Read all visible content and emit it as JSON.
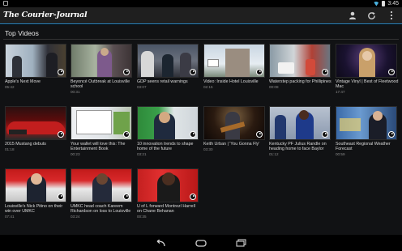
{
  "status": {
    "time": "3:45"
  },
  "app": {
    "brand": "The Courier-Journal"
  },
  "section": {
    "title": "Top Videos"
  },
  "icons": {
    "profile": "person-icon",
    "refresh": "refresh-icon",
    "overflow": "overflow-menu-icon",
    "play": "play-icon",
    "back": "back-icon",
    "home": "home-icon",
    "recents": "recents-icon"
  },
  "colors": {
    "accent": "#2b8fd1",
    "background": "#111214",
    "actionbar": "#1f1f1f"
  },
  "videos": [
    {
      "title": "Apple's Next Move",
      "duration": "05:42"
    },
    {
      "title": "Beyoncé Outbreak at Louisville school",
      "duration": "00:31"
    },
    {
      "title": "GDP seens retail warnings",
      "duration": "03:07"
    },
    {
      "title": "Video: Inside Hotel Louisville",
      "duration": "02:15"
    },
    {
      "title": "Waterstep packing for Phillipines",
      "duration": "00:08"
    },
    {
      "title": "Vintage Vinyl | Best of Fleetwood Mac",
      "duration": "17:47"
    },
    {
      "title": "2015 Mustang debuts",
      "duration": "01:18"
    },
    {
      "title": "Your wallet will love this: The Entertainment Book",
      "duration": "00:23"
    },
    {
      "title": "10 innovation trends to shape home of the future",
      "duration": "03:21"
    },
    {
      "title": "Keith Urban | 'You Gonna Fly'",
      "duration": "03:30"
    },
    {
      "title": "Kentucky PF Julius Randle on heading home to face Baylor",
      "duration": "01:12"
    },
    {
      "title": "Southeast Regional Weather Forecast",
      "duration": "00:59"
    },
    {
      "title": "Louisville's Nick Pitino on their win over UMKC",
      "duration": "07:41"
    },
    {
      "title": "UMKC head coach Kareem Richardson on loss to Louisville",
      "duration": "03:24"
    },
    {
      "title": "U of L forward Montrezl Harrell on Chane Behanan",
      "duration": "00:35"
    }
  ]
}
